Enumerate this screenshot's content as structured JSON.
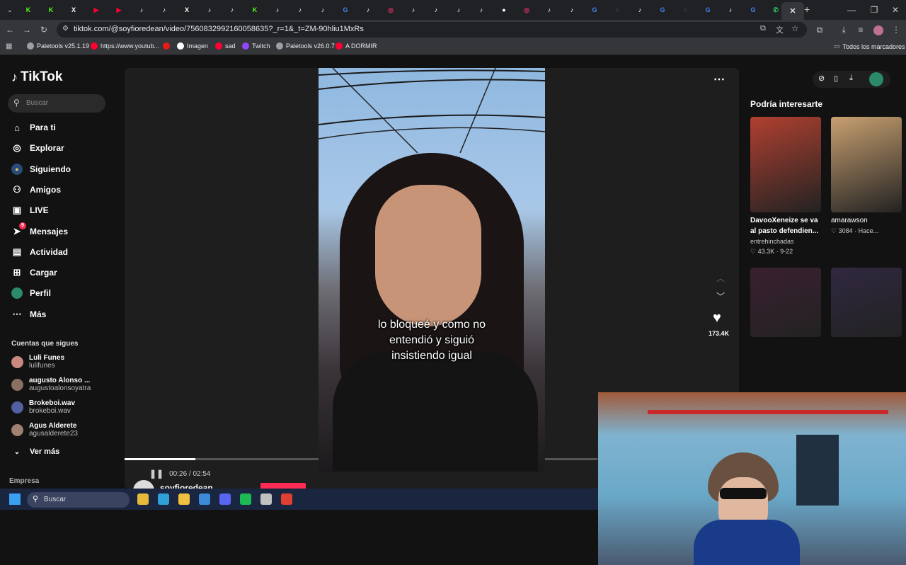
{
  "browser": {
    "tabs": [
      {
        "icon": "kick-icon",
        "color": "#53fc18",
        "glyph": "K"
      },
      {
        "icon": "kick-icon",
        "color": "#53fc18",
        "glyph": "K"
      },
      {
        "icon": "x-icon",
        "color": "#ffffff",
        "glyph": "X"
      },
      {
        "icon": "youtube-icon",
        "color": "#ff0033",
        "glyph": "▶"
      },
      {
        "icon": "youtube-icon",
        "color": "#ff0033",
        "glyph": "▶"
      },
      {
        "icon": "tiktok-icon",
        "color": "#ffffff",
        "glyph": "♪"
      },
      {
        "icon": "tiktok-icon",
        "color": "#ffffff",
        "glyph": "♪"
      },
      {
        "icon": "x-icon",
        "color": "#ffffff",
        "glyph": "X"
      },
      {
        "icon": "tiktok-icon",
        "color": "#ffffff",
        "glyph": "♪"
      },
      {
        "icon": "tiktok-icon",
        "color": "#ffffff",
        "glyph": "♪"
      },
      {
        "icon": "kick-icon",
        "color": "#53fc18",
        "glyph": "K"
      },
      {
        "icon": "tiktok-icon",
        "color": "#ffffff",
        "glyph": "♪"
      },
      {
        "icon": "tiktok-icon",
        "color": "#ffffff",
        "glyph": "♪"
      },
      {
        "icon": "tiktok-icon",
        "color": "#ffffff",
        "glyph": "♪"
      },
      {
        "icon": "google-icon",
        "color": "#4285f4",
        "glyph": "G"
      },
      {
        "icon": "tiktok-icon",
        "color": "#ffffff",
        "glyph": "♪"
      },
      {
        "icon": "instagram-icon",
        "color": "#e1306c",
        "glyph": "◎"
      },
      {
        "icon": "tiktok-icon",
        "color": "#ffffff",
        "glyph": "♪"
      },
      {
        "icon": "tiktok-icon",
        "color": "#ffffff",
        "glyph": "♪"
      },
      {
        "icon": "tiktok-icon",
        "color": "#ffffff",
        "glyph": "♪"
      },
      {
        "icon": "tiktok-icon",
        "color": "#ffffff",
        "glyph": "♪"
      },
      {
        "icon": "github-icon",
        "color": "#ffffff",
        "glyph": "●"
      },
      {
        "icon": "instagram-icon",
        "color": "#e1306c",
        "glyph": "◎"
      },
      {
        "icon": "tiktok-icon",
        "color": "#ffffff",
        "glyph": "♪"
      },
      {
        "icon": "tiktok-icon",
        "color": "#ffffff",
        "glyph": "♪"
      },
      {
        "icon": "google-icon",
        "color": "#4285f4",
        "glyph": "G"
      },
      {
        "icon": "globe-icon",
        "color": "#9aa0a6",
        "glyph": "◌"
      },
      {
        "icon": "tiktok-icon",
        "color": "#ffffff",
        "glyph": "♪"
      },
      {
        "icon": "google-icon",
        "color": "#4285f4",
        "glyph": "G"
      },
      {
        "icon": "globe-icon",
        "color": "#9aa0a6",
        "glyph": "◌"
      },
      {
        "icon": "google-icon",
        "color": "#4285f4",
        "glyph": "G"
      },
      {
        "icon": "tiktok-icon",
        "color": "#ffffff",
        "glyph": "♪"
      },
      {
        "icon": "google-icon",
        "color": "#4285f4",
        "glyph": "G"
      },
      {
        "icon": "whatsapp-icon",
        "color": "#25d366",
        "glyph": "✆"
      }
    ],
    "url": "tiktok.com/@soyfioredean/video/7560832992160058635?_r=1&_t=ZM-90hliu1MxRs",
    "bookmarks": [
      {
        "label": "Paletools v25.1.19",
        "icon": "globe-icon",
        "color": "#9aa0a6"
      },
      {
        "label": "https://www.youtub...",
        "icon": "youtube-icon",
        "color": "#ff0033"
      },
      {
        "label": "",
        "icon": "twitch-icon",
        "color": "#e91916"
      },
      {
        "label": "Imagen",
        "icon": "x-icon",
        "color": "#ffffff"
      },
      {
        "label": "sad",
        "icon": "youtube-icon",
        "color": "#ff0033"
      },
      {
        "label": "Twitch",
        "icon": "twitch-icon",
        "color": "#9146ff"
      },
      {
        "label": "Paletools v26.0.7",
        "icon": "globe-icon",
        "color": "#9aa0a6"
      },
      {
        "label": "A DORMIR",
        "icon": "youtube-icon",
        "color": "#ff0033"
      }
    ],
    "all_bookmarks": "Todos los marcadores"
  },
  "sidebar": {
    "logo": "TikTok",
    "search_placeholder": "Buscar",
    "nav": [
      {
        "label": "Para ti",
        "icon": "home-icon",
        "glyph": "⌂"
      },
      {
        "label": "Explorar",
        "icon": "compass-icon",
        "glyph": "◎"
      },
      {
        "label": "Siguiendo",
        "icon": "following-avatar-icon",
        "glyph": "●"
      },
      {
        "label": "Amigos",
        "icon": "friends-icon",
        "glyph": "⚇"
      },
      {
        "label": "LIVE",
        "icon": "live-icon",
        "glyph": "▣"
      },
      {
        "label": "Mensajes",
        "icon": "messages-icon",
        "glyph": "➤",
        "badge": "9"
      },
      {
        "label": "Actividad",
        "icon": "activity-icon",
        "glyph": "▤"
      },
      {
        "label": "Cargar",
        "icon": "upload-icon",
        "glyph": "⊞"
      },
      {
        "label": "Perfil",
        "icon": "profile-avatar-icon",
        "glyph": "●"
      },
      {
        "label": "Más",
        "icon": "more-icon",
        "glyph": "⋯"
      }
    ],
    "following_title": "Cuentas que sigues",
    "accounts": [
      {
        "name": "Luli Funes",
        "handle": "lulifunes",
        "color": "#c88a80"
      },
      {
        "name": "augusto Alonso ...",
        "handle": "augustoalonsoyatra",
        "color": "#8a7060"
      },
      {
        "name": "Brokeboi.wav",
        "handle": "brokeboi.wav",
        "color": "#5060a0"
      },
      {
        "name": "Agus Alderete",
        "handle": "agusalderete23",
        "color": "#a08070"
      }
    ],
    "see_more": "Ver más",
    "footer": "Empresa"
  },
  "video": {
    "caption_lines": [
      "lo bloqueé y como no",
      "entendió y siguió",
      "insistiendo igual"
    ],
    "time": "00:26 / 02:54",
    "progress": 0.15,
    "likes": "173.4K",
    "author": "soyfioredean"
  },
  "recommendations": {
    "title": "Podría interesarte",
    "cards": [
      {
        "title": "DavooXeneize se va al pasto defendien...",
        "author": "entrehinchadas",
        "likes": "43.3K",
        "date": "9-22",
        "color": "#b04030"
      },
      {
        "title": "amarawson",
        "author": "",
        "likes": "3084",
        "date": "Hace...",
        "color": "#c8a070"
      },
      {
        "title": "",
        "author": "",
        "likes": "",
        "date": "",
        "color": "#3a2030"
      },
      {
        "title": "",
        "author": "",
        "likes": "",
        "date": "",
        "color": "#302840"
      }
    ]
  },
  "taskbar": {
    "search_placeholder": "Buscar",
    "apps": [
      {
        "icon": "file-explorer-icon",
        "color": "#e8b83a"
      },
      {
        "icon": "edge-icon",
        "color": "#2fa0d8"
      },
      {
        "icon": "folder-icon",
        "color": "#f0c040"
      },
      {
        "icon": "store-icon",
        "color": "#3a8ad8"
      },
      {
        "icon": "discord-icon",
        "color": "#5865f2"
      },
      {
        "icon": "spotify-icon",
        "color": "#1db954"
      },
      {
        "icon": "steam-icon",
        "color": "#c0c0c0"
      },
      {
        "icon": "chrome-icon",
        "color": "#e04030"
      }
    ]
  }
}
